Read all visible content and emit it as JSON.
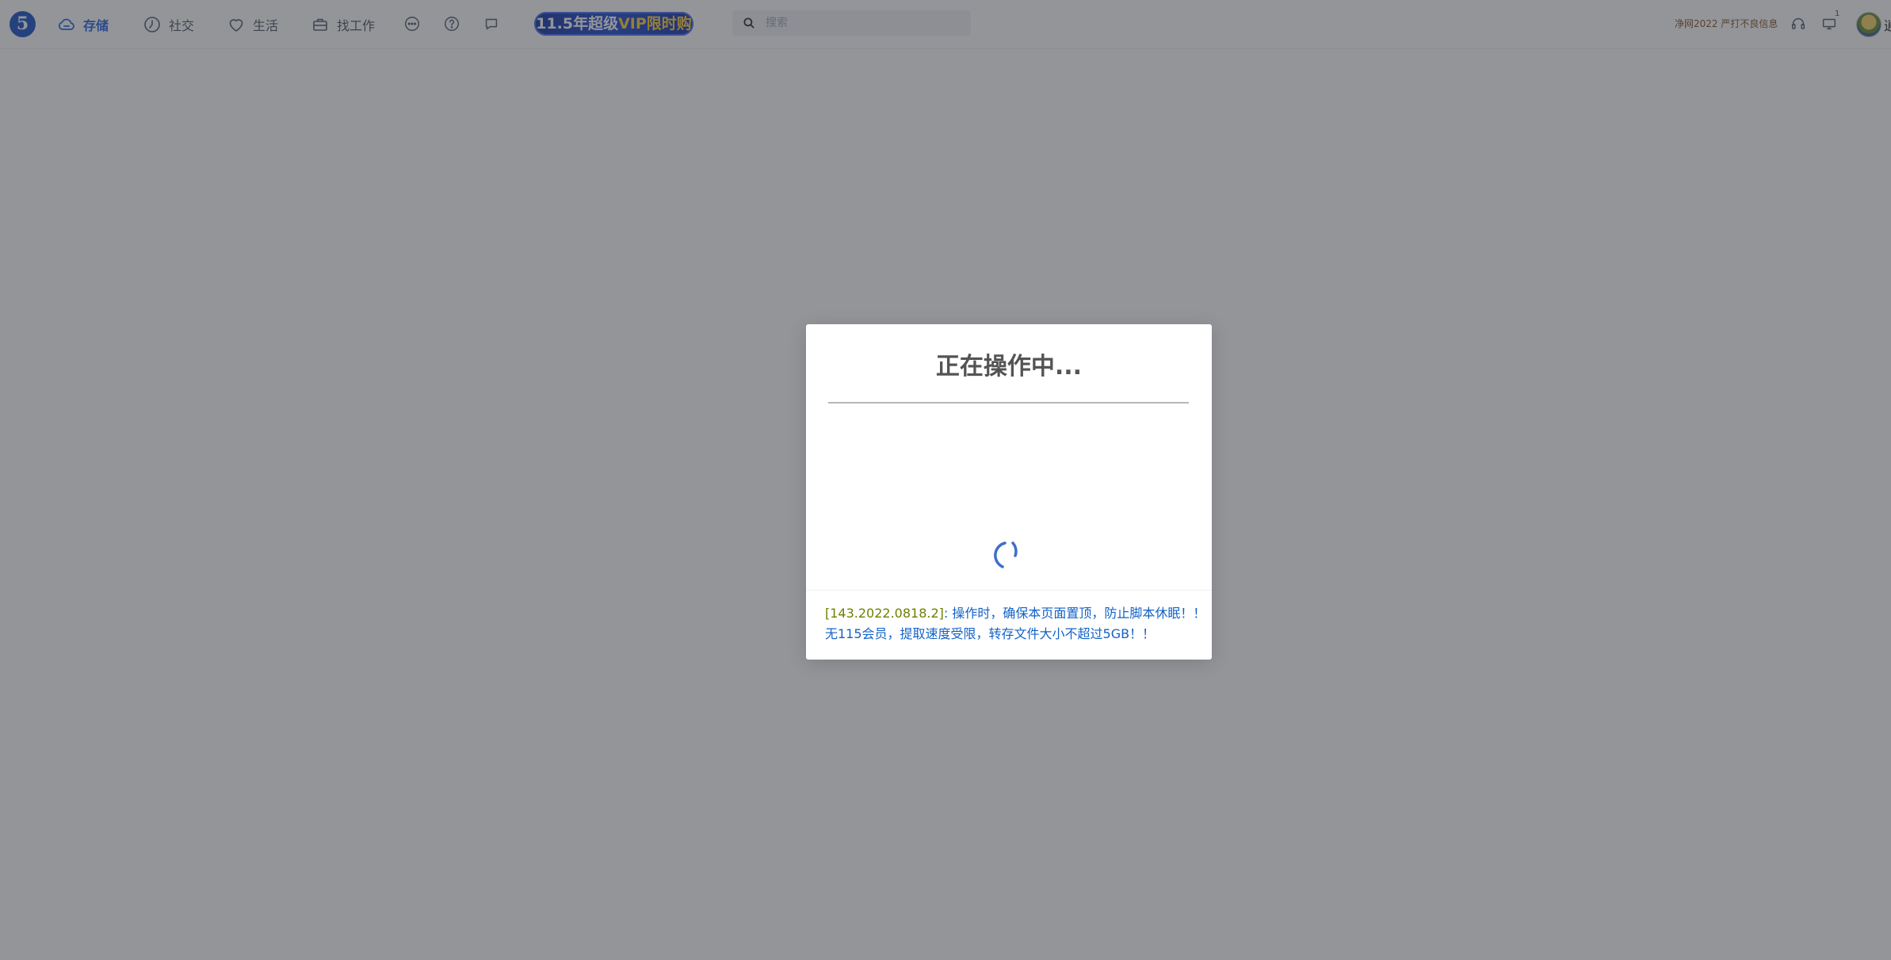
{
  "header": {
    "logo": "5",
    "nav": [
      {
        "label": "存储",
        "icon": "cloud-icon",
        "active": true
      },
      {
        "label": "社交",
        "icon": "clock-icon",
        "active": false
      },
      {
        "label": "生活",
        "icon": "heart-icon",
        "active": false
      },
      {
        "label": "找工作",
        "icon": "briefcase-icon",
        "active": false
      }
    ],
    "icons": [
      "more-icon",
      "help-icon",
      "message-icon"
    ],
    "promo": {
      "prefix": "11.5年超级",
      "highlight": "VIP",
      "suffix": "限时购"
    },
    "search": {
      "placeholder": "搜索"
    },
    "notice": "净网2022 严打不良信息",
    "right_icons": [
      "headset-icon",
      "screen-icon"
    ],
    "screen_badge": "1",
    "user_initial": "逍"
  },
  "modal": {
    "title": "正在操作中...",
    "footer": {
      "version": "[143.2022.0818.2]",
      "line1_message": ": 操作时，确保本页面置顶，防止脚本休眠！！",
      "line2_message": "无115会员，提取速度受限，转存文件大小不超过5GB！！"
    }
  },
  "colors": {
    "accent": "#2e6ae6",
    "overlay": "rgba(40,44,52,0.5)",
    "version_text": "#6f7f00",
    "message_text": "#1262c7"
  }
}
